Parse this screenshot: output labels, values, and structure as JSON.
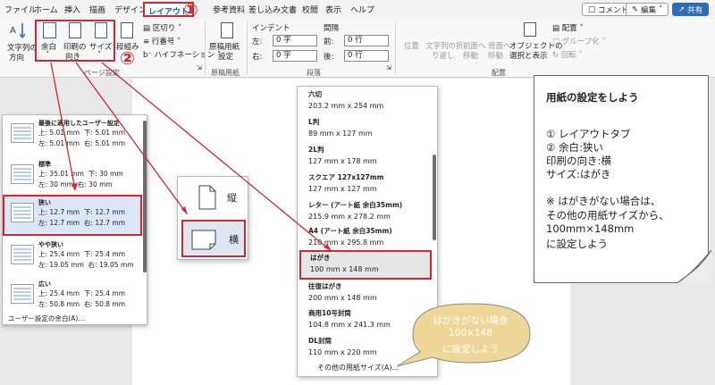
{
  "tabs": [
    "ファイル",
    "ホーム",
    "挿入",
    "描画",
    "デザイン",
    "レイアウト",
    "参考資料",
    "差し込み文書",
    "校閲",
    "表示",
    "ヘルプ"
  ],
  "top_buttons": {
    "comment": "コメント",
    "edit": "編集",
    "share": "共有"
  },
  "ribbon": {
    "text_direction": [
      "文字列の",
      "方向"
    ],
    "margins": "余白",
    "orientation": [
      "印刷の",
      "向き"
    ],
    "size": "サイズ",
    "columns": "段組み",
    "breaks": "区切り",
    "line_numbers": "行番号",
    "hyphenation": "ハイフネーション",
    "group_page_setup": "ページ設定",
    "manuscript": [
      "原稿用紙",
      "設定"
    ],
    "group_manuscript": "原稿用紙",
    "indent_label": "インデント",
    "spacing_label": "間隔",
    "indent_left_label": "左:",
    "indent_left": "0 字",
    "indent_right_label": "右:",
    "indent_right": "0 字",
    "spacing_before_label": "前:",
    "spacing_before": "0 行",
    "spacing_after_label": "後:",
    "spacing_after": "0 行",
    "group_paragraph": "段落",
    "position": "位置",
    "wrap_text": [
      "文字列の折",
      "り返し"
    ],
    "bring_forward": [
      "前面へ",
      "移動"
    ],
    "send_backward": [
      "背面へ",
      "移動"
    ],
    "selection_pane": [
      "オブジェクトの",
      "選択と表示"
    ],
    "align": "配置",
    "group": "グループ化",
    "rotate": "回転",
    "group_arrange": "配置"
  },
  "steps": {
    "one": "①",
    "two": "②"
  },
  "margin_menu": {
    "options": [
      {
        "title": "最後に適用したユーザー設定",
        "top": "5.01 mm",
        "bottom": "5.01 mm",
        "left": "5.01 mm",
        "right": "5.01 mm"
      },
      {
        "title": "標準",
        "top": "35.01 mm",
        "bottom": "30 mm",
        "left": "30 mm",
        "right": "30 mm"
      },
      {
        "title": "狭い",
        "top": "12.7 mm",
        "bottom": "12.7 mm",
        "left": "12.7 mm",
        "right": "12.7 mm"
      },
      {
        "title": "やや狭い",
        "top": "25.4 mm",
        "bottom": "25.4 mm",
        "left": "19.05 mm",
        "right": "19.05 mm"
      },
      {
        "title": "広い",
        "top": "25.4 mm",
        "bottom": "25.4 mm",
        "left": "50.8 mm",
        "right": "50.8 mm"
      }
    ],
    "labels": {
      "top": "上:",
      "bottom": "下:",
      "left": "左:",
      "right": "右:"
    },
    "custom": "ユーザー設定の余白(A)..."
  },
  "orientation_menu": {
    "portrait": "縦",
    "landscape": "横"
  },
  "size_menu": {
    "items": [
      {
        "name": "六切",
        "dims": "203.2 mm x 254 mm"
      },
      {
        "name": "L判",
        "dims": "89 mm x 127 mm"
      },
      {
        "name": "2L判",
        "dims": "127 mm x 178 mm"
      },
      {
        "name": "スクエア 127x127mm",
        "dims": "127 mm x 127 mm"
      },
      {
        "name": "レター (アート紙 余白35mm)",
        "dims": "215.9 mm x 278.2 mm"
      },
      {
        "name": "A4 (アート紙 余白35mm)",
        "dims": "210 mm x 295.8 mm"
      },
      {
        "name": "はがき",
        "dims": "100 mm x 148 mm"
      },
      {
        "name": "往復はがき",
        "dims": "200 mm x 148 mm"
      },
      {
        "name": "商用10号封筒",
        "dims": "104.8 mm x 241.3 mm"
      },
      {
        "name": "DL封筒",
        "dims": "110 mm x 220 mm"
      }
    ],
    "more": "その他の用紙サイズ(A)..."
  },
  "note": {
    "title": "用紙の設定をしよう",
    "lines": [
      "①  レイアウトタブ",
      "②  余白:狭い",
      "     印刷の向き:横",
      "     サイズ:はがき",
      "",
      "※ はがきがない場合は、",
      "その他の用紙サイズから、",
      "100mm×148mm",
      "に設定しよう"
    ]
  },
  "bubble": {
    "lines": [
      "はがきがない場合",
      "100×148",
      "に設定しよう"
    ]
  },
  "colors": {
    "accent_red": "#d7262e",
    "word_blue": "#185abd",
    "bubble_fill": "#eed798"
  }
}
